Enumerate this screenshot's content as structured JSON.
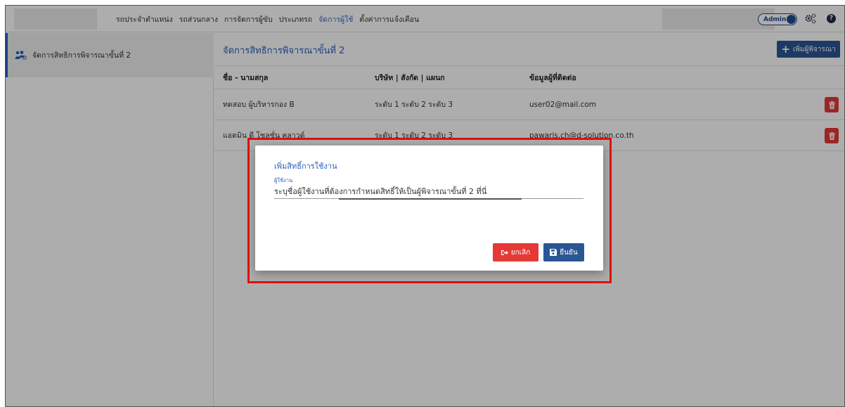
{
  "topnav": {
    "items": [
      {
        "label": "รถประจำตำแหน่ง",
        "active": false
      },
      {
        "label": "รถส่วนกลาง",
        "active": false
      },
      {
        "label": "การจัดการผู้ขับ",
        "active": false
      },
      {
        "label": "ประเภทรถ",
        "active": false
      },
      {
        "label": "จัดการผู้ใช้",
        "active": true
      },
      {
        "label": "ตั้งค่าการแจ้งเตือน",
        "active": false
      }
    ],
    "admin_label": "Admin",
    "help_label": "?"
  },
  "sidebar": {
    "items": [
      {
        "label": "จัดการสิทธิการพิจารณาขั้นที่ 2",
        "icon": "users-cog-icon"
      }
    ]
  },
  "main": {
    "title": "จัดการสิทธิการพิจารณาขั้นที่ 2",
    "add_button_label": "เพิ่มผู้พิจารณา",
    "table": {
      "headers": [
        "ชื่อ - นามสกุล",
        "บริษัท | สังกัด | แผนก",
        "ข้อมูลผู้ที่ติดต่อ"
      ],
      "rows": [
        {
          "name": "ทดสอบ ผู้บริหารกอง B",
          "org": "ระดับ 1 ระดับ 2 ระดับ 3",
          "contact": "user02@mail.com"
        },
        {
          "name": "แอดมิน ดี โซลูชั่น คลาวด์",
          "org": "ระดับ 1 ระดับ 2 ระดับ 3",
          "contact": "pawaris.ch@d-solution.co.th"
        }
      ]
    }
  },
  "modal": {
    "title": "เพิ่มสิทธิ์การใช้งาน",
    "field_label": "ผู้ใช้งาน",
    "field_placeholder": "ระบุชื่อผู้ใช้งานที่ต้องการกำหนดสิทธิ์ให้เป็นผู้พิจารณาขั้นที่ 2 ที่นี่",
    "cancel_label": "ยกเลิก",
    "confirm_label": "ยืนยัน"
  },
  "colors": {
    "primary": "#2b5694",
    "link": "#2b5fbd",
    "danger": "#e53935",
    "highlight": "#e01010"
  }
}
